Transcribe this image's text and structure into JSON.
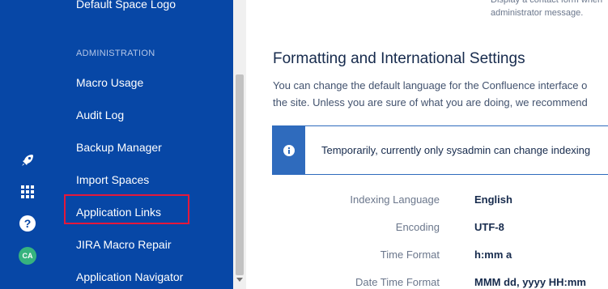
{
  "top_note": {
    "line1": "Display a contact form when",
    "line2": "administrator message."
  },
  "sidebar": {
    "top_item": "Default Space Logo",
    "heading": "ADMINISTRATION",
    "items": [
      {
        "label": "Macro Usage"
      },
      {
        "label": "Audit Log"
      },
      {
        "label": "Backup Manager"
      },
      {
        "label": "Import Spaces"
      },
      {
        "label": "Application Links"
      },
      {
        "label": "JIRA Macro Repair"
      },
      {
        "label": "Application Navigator"
      }
    ],
    "highlighted_item": "Application Links",
    "highlight_color": "#e5183b"
  },
  "rail": {
    "icons": [
      "rocket-icon",
      "app-switcher-icon",
      "help-icon"
    ],
    "avatar_initials": "CA"
  },
  "main": {
    "title": "Formatting and International Settings",
    "description_line1": "You can change the default language for the Confluence interface o",
    "description_line2": "the site. Unless you are sure of what you are doing, we recommend",
    "info_message": "Temporarily, currently only sysadmin can change indexing",
    "settings": [
      {
        "label": "Indexing Language",
        "value": "English"
      },
      {
        "label": "Encoding",
        "value": "UTF-8"
      },
      {
        "label": "Time Format",
        "value": "h:mm a"
      },
      {
        "label": "Date Time Format",
        "value": "MMM dd, yyyy HH:mm"
      }
    ]
  },
  "colors": {
    "sidebar_bg": "#0747a6",
    "accent": "#2f6bbd",
    "avatar_bg": "#36b37e"
  }
}
